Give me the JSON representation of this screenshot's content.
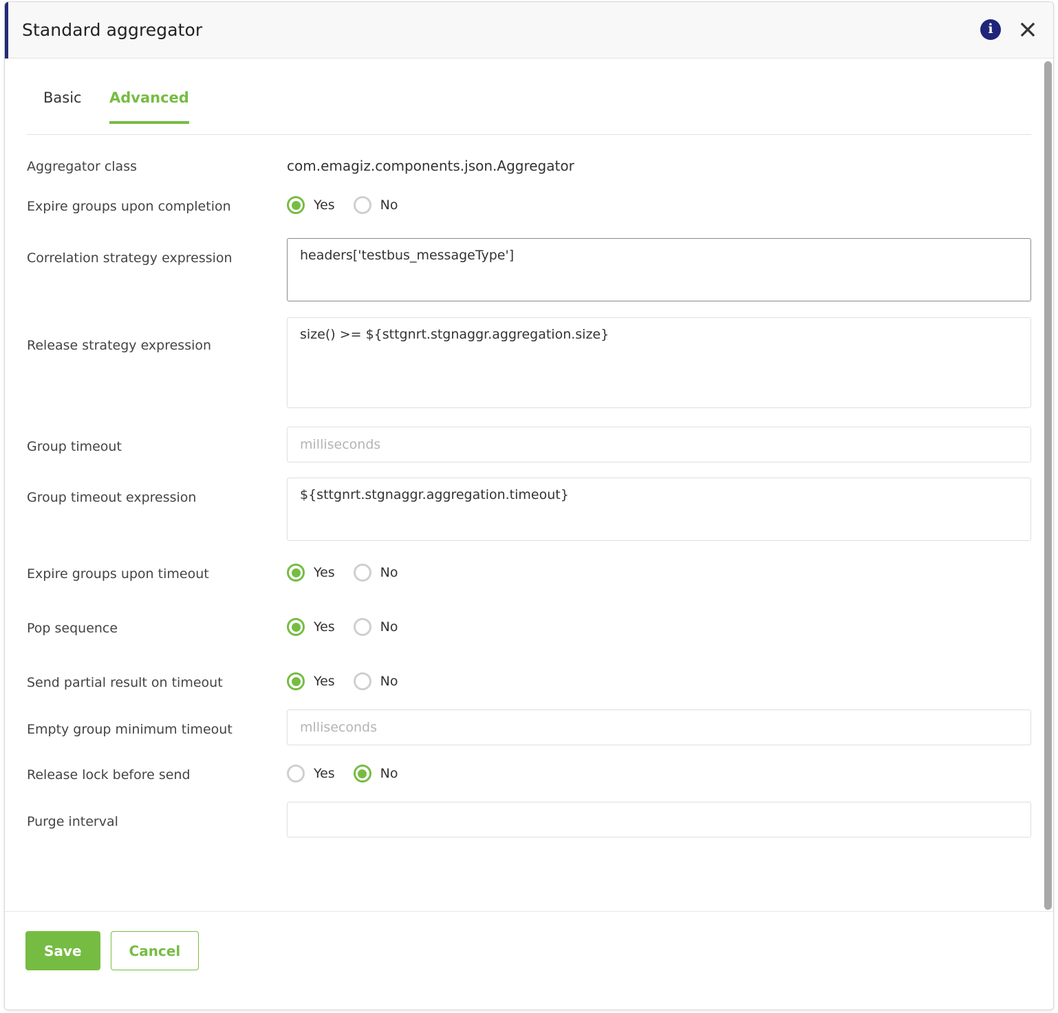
{
  "window": {
    "title": "Standard aggregator",
    "info_icon": "info-icon",
    "close_icon": "close-icon",
    "accent_color": "#252a77"
  },
  "tabs": [
    {
      "label": "Basic",
      "active": false
    },
    {
      "label": "Advanced",
      "active": true
    }
  ],
  "theme": {
    "accent_green": "#76bc43",
    "info_blue": "#1f2578",
    "text": "#333333",
    "placeholder": "#b4b4b4",
    "border": "#dedede"
  },
  "form": {
    "aggregator_class": {
      "label": "Aggregator class",
      "value": "com.emagiz.components.json.Aggregator"
    },
    "expire_groups_upon_completion": {
      "label": "Expire groups upon completion",
      "options": [
        "Yes",
        "No"
      ],
      "selected": "Yes"
    },
    "correlation_strategy_expression": {
      "label": "Correlation strategy expression",
      "value": "headers['testbus_messageType']",
      "placeholder": ""
    },
    "release_strategy_expression": {
      "label": "Release strategy expression",
      "value": "size() >= ${sttgnrt.stgnaggr.aggregation.size}",
      "placeholder": ""
    },
    "group_timeout": {
      "label": "Group timeout",
      "value": "",
      "placeholder": "milliseconds"
    },
    "group_timeout_expression": {
      "label": "Group timeout expression",
      "value": "${sttgnrt.stgnaggr.aggregation.timeout}",
      "placeholder": ""
    },
    "expire_groups_upon_timeout": {
      "label": "Expire groups upon timeout",
      "options": [
        "Yes",
        "No"
      ],
      "selected": "Yes"
    },
    "pop_sequence": {
      "label": "Pop sequence",
      "options": [
        "Yes",
        "No"
      ],
      "selected": "Yes"
    },
    "send_partial_result_on_timeout": {
      "label": "Send partial result on timeout",
      "options": [
        "Yes",
        "No"
      ],
      "selected": "Yes"
    },
    "empty_group_minimum_timeout": {
      "label": "Empty group minimum timeout",
      "value": "",
      "placeholder": "mlliseconds"
    },
    "release_lock_before_send": {
      "label": "Release lock before send",
      "options": [
        "Yes",
        "No"
      ],
      "selected": "No"
    },
    "purge_interval": {
      "label": "Purge interval",
      "value": "",
      "placeholder": ""
    }
  },
  "footer": {
    "save_label": "Save",
    "cancel_label": "Cancel"
  }
}
